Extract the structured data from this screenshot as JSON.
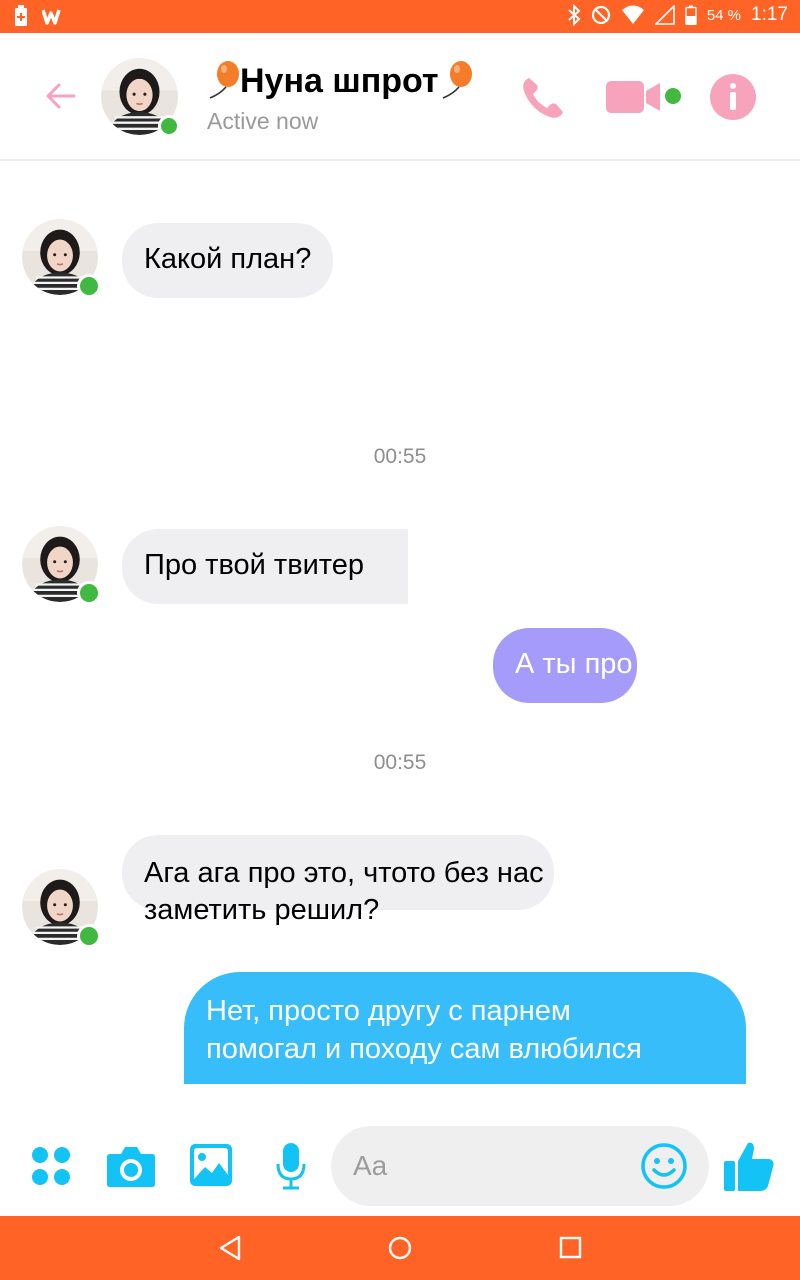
{
  "status_bar": {
    "battery_percent": "54 %",
    "time": "1:17",
    "icons": [
      "battery-plus-icon",
      "w-app-icon",
      "bluetooth-icon",
      "do-not-disturb-icon",
      "wifi-icon",
      "signal-icon",
      "battery-icon"
    ]
  },
  "header": {
    "title": "Нуна шпрот",
    "status": "Active now",
    "icons": [
      "back-arrow-icon",
      "balloon-icon",
      "phone-icon",
      "video-camera-icon",
      "info-icon"
    ]
  },
  "messages": [
    {
      "id": 1,
      "direction": "incoming",
      "text": "Какой план?"
    },
    {
      "id": 2,
      "type": "timestamp",
      "text": "00:55"
    },
    {
      "id": 3,
      "direction": "incoming",
      "text": "Про твой твитер"
    },
    {
      "id": 4,
      "direction": "outgoing",
      "text": "А ты про"
    },
    {
      "id": 5,
      "type": "timestamp",
      "text": "00:55"
    },
    {
      "id": 6,
      "direction": "incoming",
      "line1": "Ага ага про это, чтото без нас",
      "line2": "заметить решил?"
    },
    {
      "id": 7,
      "direction": "outgoing",
      "line1": "Нет, просто другу с парнем",
      "line2": "помогал и походу сам влюбился"
    }
  ],
  "composer": {
    "placeholder": "Aa",
    "icons": [
      "apps-grid-icon",
      "camera-icon",
      "gallery-icon",
      "microphone-icon",
      "emoji-icon",
      "thumbs-up-icon"
    ]
  },
  "nav_bar": {
    "icons": [
      "back-triangle-icon",
      "home-circle-icon",
      "recents-square-icon"
    ]
  },
  "colors": {
    "system_bar": "#ff6325",
    "accent_pink": "#f7a3bc",
    "composer_blue": "#14c3f5",
    "online_green": "#3fb93f",
    "bubble_incoming": "#efeef1",
    "bubble_outgoing_purple": "#a89af8",
    "bubble_outgoing_blue": "#38bdfb"
  }
}
